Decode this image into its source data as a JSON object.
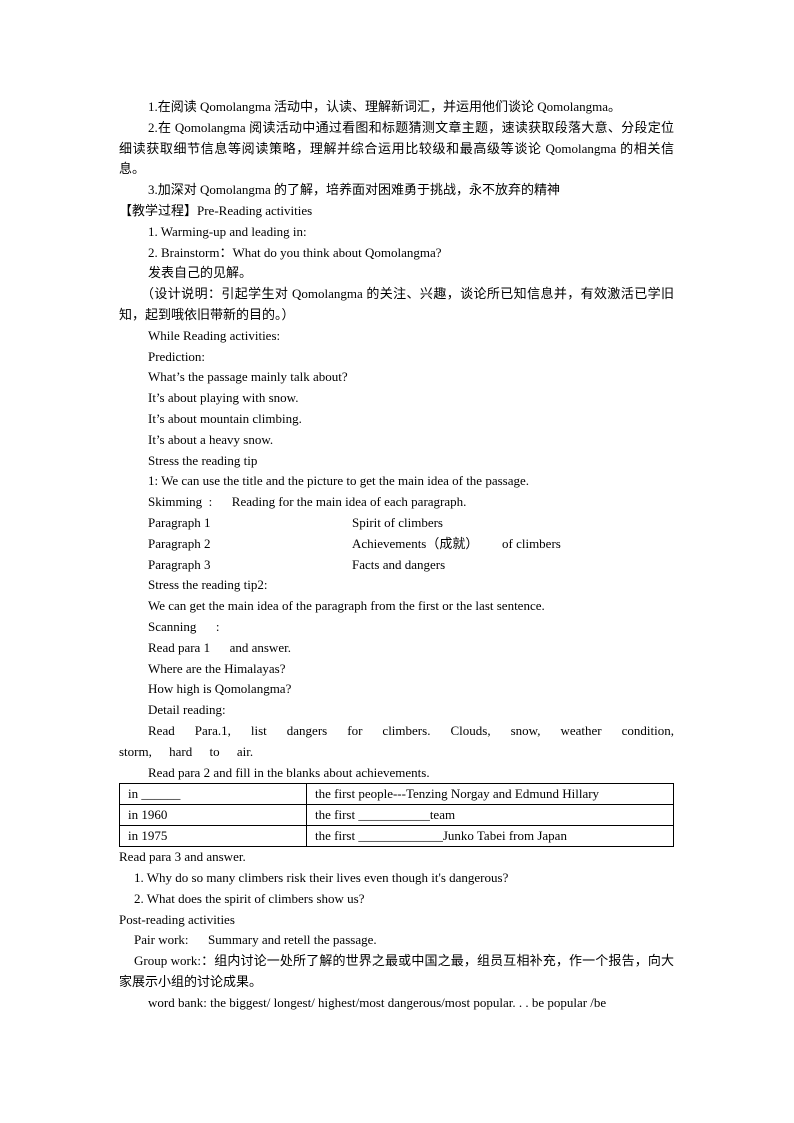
{
  "objectives": [
    "1.在阅读 Qomolangma 活动中，认读、理解新词汇，并运用他们谈论 Qomolangma。",
    "2.在 Qomolangma 阅读活动中通过看图和标题猜测文章主题，速读获取段落大意、分段定位细读获取细节信息等阅读策略，理解并综合运用比较级和最高级等谈论 Qomolangma 的相关信息。",
    "3.加深对 Qomolangma 的了解，培养面对困难勇于挑战，永不放弃的精神"
  ],
  "process_heading": "【教学过程】Pre-Reading activities",
  "pre": [
    "1. Warming-up and leading in:",
    "2. Brainstorm：What do you think about Qomolangma?",
    "发表自己的见解。"
  ],
  "design_note": "（设计说明：引起学生对 Qomolangma 的关注、兴趣，谈论所已知信息并，有效激活已学旧知，起到哦依旧带新的目的。）",
  "while": [
    "While Reading activities:",
    "Prediction:",
    "What’s the passage mainly talk about?",
    "It’s about playing with snow.",
    "It’s about mountain climbing.",
    "It’s about a heavy snow.",
    "Stress the reading tip",
    "1: We can use the title and the picture to get the main idea of the passage.",
    "Skimming  :      Reading for the main idea of each paragraph."
  ],
  "paragraphs": [
    {
      "label": "Paragraph 1",
      "idea": "Spirit of climbers",
      "extra": ""
    },
    {
      "label": "Paragraph 2",
      "idea": "Achievements（成就）",
      "extra": "of climbers"
    },
    {
      "label": "Paragraph 3",
      "idea": "Facts and dangers",
      "extra": ""
    }
  ],
  "while2": [
    "Stress the reading tip2:",
    "We can get the main idea of the paragraph from the first or the last sentence.",
    "Scanning      :",
    "Read para 1      and answer.",
    "Where are the Himalayas?",
    "How high is Qomolangma?",
    "Detail reading:"
  ],
  "detail_para": "Read Para.1, list dangers for climbers. Clouds, snow, weather condition, storm, hard to air.",
  "fill_instr": "Read para 2 and fill in the blanks about achievements.",
  "table": [
    [
      "in ______",
      "the first people---Tenzing Norgay and Edmund Hillary"
    ],
    [
      "in 1960",
      "the first ___________team"
    ],
    [
      "in 1975",
      "the first _____________Junko Tabei from Japan"
    ]
  ],
  "para3": "Read para 3 and answer.",
  "para3_q": [
    "1. Why do so many climbers risk their lives even though it's dangerous?",
    "2. What does the spirit of climbers show us?"
  ],
  "post_heading": "Post-reading activities",
  "pair_work": "Pair work:      Summary and retell the passage.",
  "group_work": "Group work:：组内讨论一处所了解的世界之最或中国之最，组员互相补充，作一个报告，向大家展示小组的讨论成果。",
  "word_bank": "word bank: the biggest/ longest/ highest/most dangerous/most popular. . . be popular /be"
}
